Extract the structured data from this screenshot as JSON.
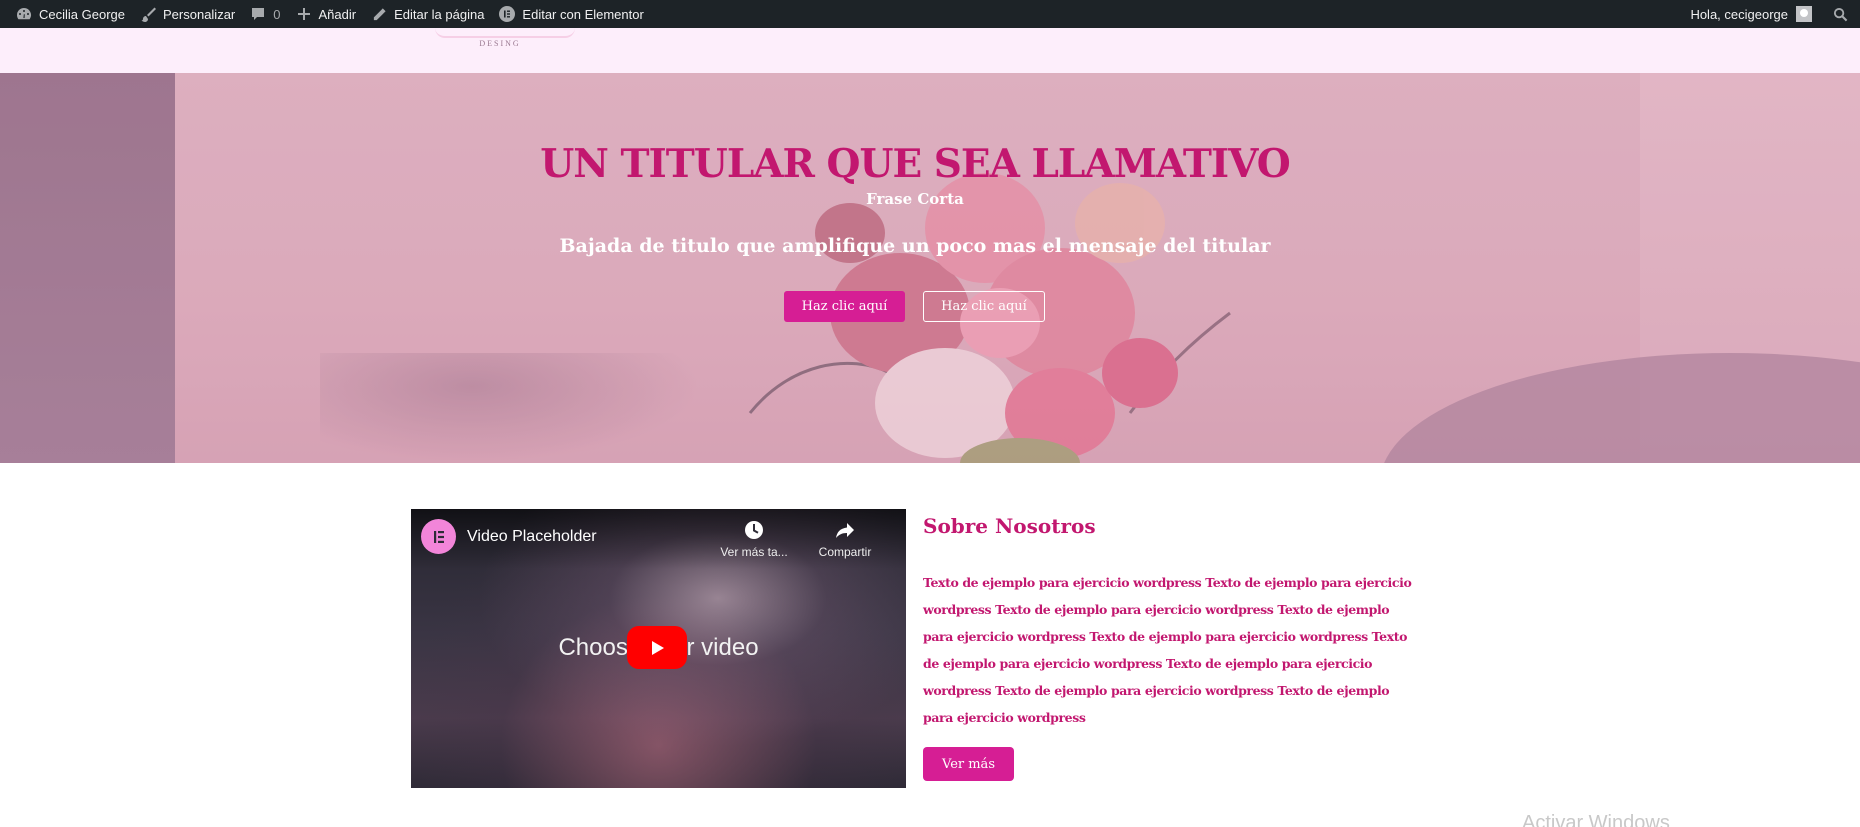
{
  "admin_bar": {
    "site_name": "Cecilia George",
    "customize": "Personalizar",
    "comments_count": "0",
    "add_new": "Añadir",
    "edit_page": "Editar la página",
    "edit_elementor": "Editar con Elementor",
    "greeting": "Hola, cecigeorge"
  },
  "header": {
    "logo_text": "DESING"
  },
  "hero": {
    "title": "UN TITULAR QUE SEA LLAMATIVO",
    "phrase": "Frase Corta",
    "subtitle": "Bajada de titulo que amplifique un poco mas el mensaje del titular",
    "primary_button": "Haz clic aquí",
    "secondary_button": "Haz clic aquí"
  },
  "about": {
    "video": {
      "title": "Video Placeholder",
      "watch_later": "Ver más ta...",
      "share": "Compartir",
      "center_text": "Choose your video"
    },
    "title": "Sobre Nosotros",
    "body": "Texto de ejemplo para ejercicio wordpress Texto de ejemplo para ejercicio wordpress Texto de ejemplo para ejercicio wordpress Texto de ejemplo para ejercicio wordpress Texto de ejemplo para ejercicio wordpress Texto de ejemplo para ejercicio wordpress Texto de ejemplo para ejercicio wordpress Texto de ejemplo para ejercicio wordpress Texto de ejemplo para ejercicio wordpress",
    "button": "Ver más"
  },
  "watermark": "Activar Windows",
  "colors": {
    "brand_pink": "#d61e94",
    "title_magenta": "#c2176f",
    "admin_bar": "#1d2327",
    "header_bg": "#fdeefb"
  },
  "icons": [
    "dashboard-icon",
    "brush-icon",
    "comment-icon",
    "plus-icon",
    "pencil-icon",
    "elementor-icon",
    "avatar",
    "search-icon",
    "clock-icon",
    "share-icon",
    "youtube-play-icon"
  ]
}
